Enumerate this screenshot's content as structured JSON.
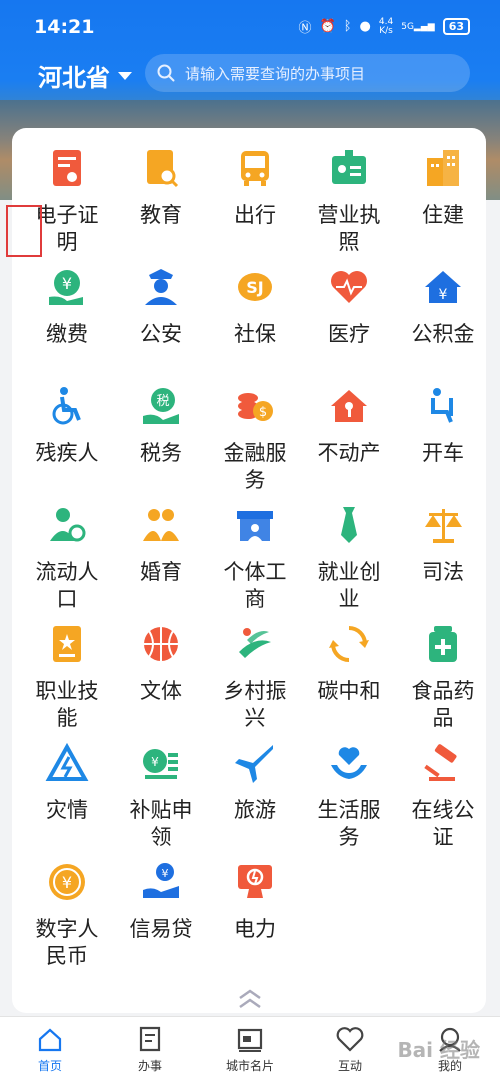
{
  "status": {
    "time": "14:21",
    "net_speed_top": "4.4",
    "net_speed_bottom": "K/s",
    "signal": "5G",
    "battery": "63"
  },
  "header": {
    "province": "河北省",
    "search_placeholder": "请输入需要查询的办事项目"
  },
  "services": [
    {
      "label": "电子证明",
      "icon": "certificate-icon",
      "color": "#f05a3c"
    },
    {
      "label": "教育",
      "icon": "education-icon",
      "color": "#f5a623"
    },
    {
      "label": "出行",
      "icon": "bus-icon",
      "color": "#f5a623"
    },
    {
      "label": "营业执照",
      "icon": "business-license-icon",
      "color": "#2db47d"
    },
    {
      "label": "住建",
      "icon": "building-icon",
      "color": "#f5a623"
    },
    {
      "label": "缴费",
      "icon": "payment-icon",
      "color": "#2db47d"
    },
    {
      "label": "公安",
      "icon": "police-icon",
      "color": "#1e6fe0"
    },
    {
      "label": "社保",
      "icon": "social-security-icon",
      "color": "#f5a623"
    },
    {
      "label": "医疗",
      "icon": "medical-heart-icon",
      "color": "#f05a3c"
    },
    {
      "label": "公积金",
      "icon": "housing-fund-icon",
      "color": "#1e6fe0"
    },
    {
      "label": "残疾人",
      "icon": "wheelchair-icon",
      "color": "#1e88e5"
    },
    {
      "label": "税务",
      "icon": "tax-icon",
      "color": "#2db47d"
    },
    {
      "label": "金融服务",
      "icon": "coins-icon",
      "color": "#f05a3c"
    },
    {
      "label": "不动产",
      "icon": "real-estate-icon",
      "color": "#f05a3c"
    },
    {
      "label": "开车",
      "icon": "driver-icon",
      "color": "#1e88e5"
    },
    {
      "label": "流动人口",
      "icon": "migrant-icon",
      "color": "#2db47d"
    },
    {
      "label": "婚育",
      "icon": "marriage-icon",
      "color": "#f5a623"
    },
    {
      "label": "个体工商",
      "icon": "shop-icon",
      "color": "#1e6fe0"
    },
    {
      "label": "就业创业",
      "icon": "tie-icon",
      "color": "#2db47d"
    },
    {
      "label": "司法",
      "icon": "scales-icon",
      "color": "#f5a623"
    },
    {
      "label": "职业技能",
      "icon": "skill-certificate-icon",
      "color": "#f5a623"
    },
    {
      "label": "文体",
      "icon": "basketball-icon",
      "color": "#f05a3c"
    },
    {
      "label": "乡村振兴",
      "icon": "rural-revitalization-icon",
      "color": "#2db47d"
    },
    {
      "label": "碳中和",
      "icon": "recycle-icon",
      "color": "#f5a623"
    },
    {
      "label": "食品药品",
      "icon": "medicine-icon",
      "color": "#2db47d"
    },
    {
      "label": "灾情",
      "icon": "disaster-icon",
      "color": "#1e88e5"
    },
    {
      "label": "补贴申领",
      "icon": "subsidy-icon",
      "color": "#2db47d"
    },
    {
      "label": "旅游",
      "icon": "airplane-icon",
      "color": "#1e88e5"
    },
    {
      "label": "生活服务",
      "icon": "life-service-icon",
      "color": "#1e88e5"
    },
    {
      "label": "在线公证",
      "icon": "gavel-icon",
      "color": "#f05a3c"
    },
    {
      "label": "数字人民币",
      "icon": "digital-yuan-icon",
      "color": "#f5a623"
    },
    {
      "label": "信易贷",
      "icon": "credit-loan-icon",
      "color": "#1e6fe0"
    },
    {
      "label": "电力",
      "icon": "electric-power-icon",
      "color": "#f05a3c"
    }
  ],
  "tabs": [
    {
      "label": "首页",
      "icon": "home-icon",
      "active": true
    },
    {
      "label": "办事",
      "icon": "document-icon",
      "active": false
    },
    {
      "label": "城市名片",
      "icon": "city-card-icon",
      "active": false
    },
    {
      "label": "互动",
      "icon": "heart-icon",
      "active": false
    },
    {
      "label": "我的",
      "icon": "profile-icon",
      "active": false
    }
  ],
  "colors": {
    "brand": "#1677f0",
    "highlight_box": "#e03b3b"
  }
}
